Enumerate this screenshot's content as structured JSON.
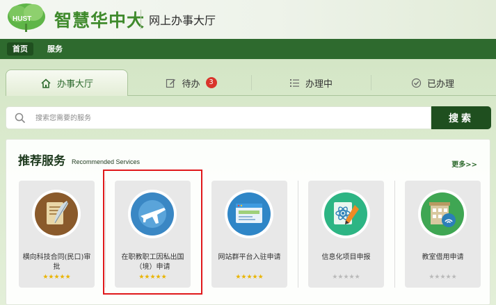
{
  "header": {
    "brand": "智慧华中大",
    "subtitle": "网上办事大厅"
  },
  "nav": {
    "home": "首页",
    "service": "服务"
  },
  "tabs": [
    {
      "label": "办事大厅",
      "icon": "home-icon"
    },
    {
      "label": "待办",
      "icon": "edit-icon",
      "badge": "3"
    },
    {
      "label": "办理中",
      "icon": "list-icon"
    },
    {
      "label": "已办理",
      "icon": "check-circle-icon"
    }
  ],
  "search": {
    "placeholder": "搜索您需要的服务",
    "button": "搜索"
  },
  "recommended": {
    "title": "推荐服务",
    "subtitle": "Recommended Services",
    "more": "更多>>",
    "cards": [
      {
        "label": "横向科技合同(民口)审批",
        "stars": "★★★★★",
        "rated": true,
        "icon": "contract-quill-icon",
        "color": "#8a5a2b"
      },
      {
        "label": "在职教职工因私出国（境）申请",
        "stars": "★★★★★",
        "rated": true,
        "icon": "airplane-icon",
        "color": "#3a87c4"
      },
      {
        "label": "网站群平台入驻申请",
        "stars": "★★★★★",
        "rated": true,
        "icon": "web-window-icon",
        "color": "#2f86c7"
      },
      {
        "label": "信息化项目申报",
        "stars": "★★★★★",
        "rated": false,
        "icon": "atom-pencil-icon",
        "color": "#2db584"
      },
      {
        "label": "教室借用申请",
        "stars": "★★★★★",
        "rated": false,
        "icon": "building-wifi-icon",
        "color": "#3fa653"
      }
    ]
  },
  "colors": {
    "nav_bg": "#2e6a2e",
    "brand_green": "#3f8a2c",
    "badge_red": "#d9342b",
    "highlight_red": "#e0181b",
    "star_gold": "#e9b400"
  }
}
